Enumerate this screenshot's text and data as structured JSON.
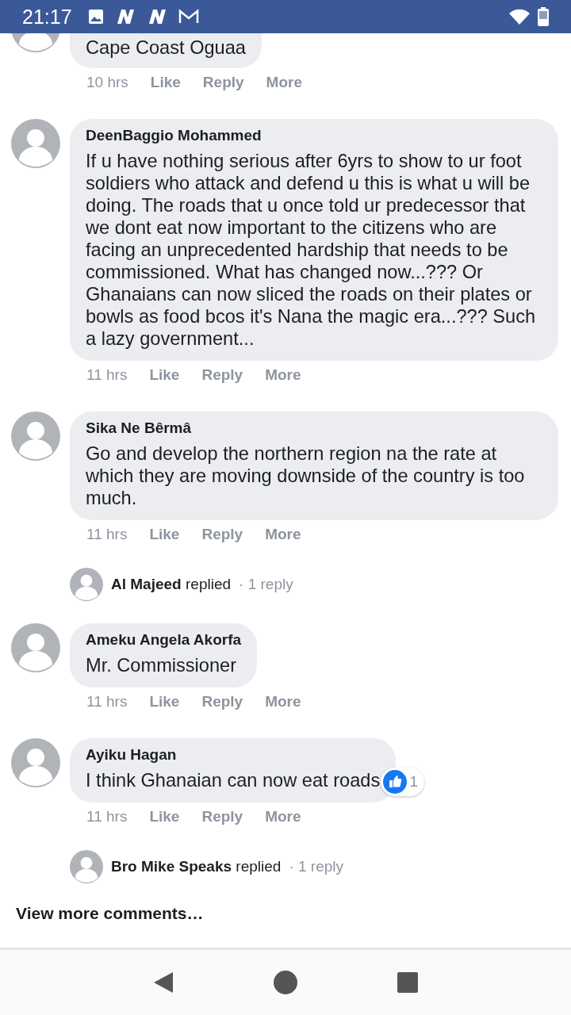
{
  "status_bar": {
    "time": "21:17"
  },
  "comments": [
    {
      "text": "Cape Coast Oguaa",
      "time": "10 hrs",
      "actions": [
        "Like",
        "Reply",
        "More"
      ]
    },
    {
      "name": "DeenBaggio Mohammed",
      "text": "If u have nothing serious after 6yrs to show to ur foot soldiers who attack and defend u this is what u will be doing. The roads that u once told ur predecessor that we dont eat now important to the citizens who are facing an unprecedented hardship that needs to be commissioned. What has changed now...??? Or Ghanaians can now sliced the roads on their plates or bowls as food bcos it's Nana the magic era...??? Such a lazy government...",
      "time": "11 hrs",
      "actions": [
        "Like",
        "Reply",
        "More"
      ]
    },
    {
      "name": "Sika Ne Bêrmâ",
      "text": "Go and develop the northern region na the rate at which they are moving downside of the country is too much.",
      "time": "11 hrs",
      "actions": [
        "Like",
        "Reply",
        "More"
      ],
      "reply_summary": {
        "name": "Al Majeed",
        "verb": "replied",
        "count": "· 1 reply"
      }
    },
    {
      "name": "Ameku Angela Akorfa",
      "text": "Mr. Commissioner",
      "time": "11 hrs",
      "actions": [
        "Like",
        "Reply",
        "More"
      ]
    },
    {
      "name": "Ayiku Hagan",
      "text": "I think Ghanaian can now eat roads",
      "time": "11 hrs",
      "actions": [
        "Like",
        "Reply",
        "More"
      ],
      "reactions": "1",
      "reply_summary": {
        "name": "Bro Mike Speaks",
        "verb": "replied",
        "count": "· 1 reply"
      }
    }
  ],
  "view_more": "View more comments…"
}
